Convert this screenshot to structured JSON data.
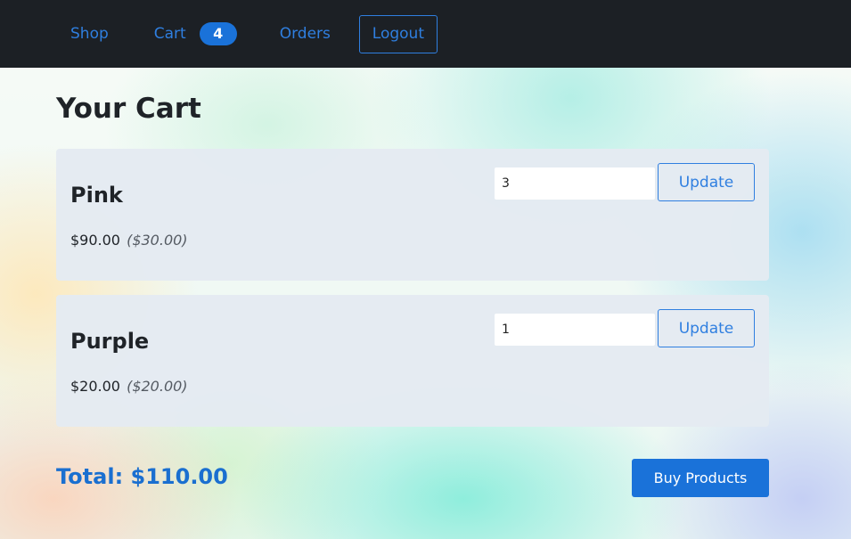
{
  "nav": {
    "shop_label": "Shop",
    "cart_label": "Cart",
    "cart_count": "4",
    "orders_label": "Orders",
    "logout_label": "Logout"
  },
  "page": {
    "title": "Your Cart"
  },
  "cart": {
    "items": [
      {
        "name": "Pink",
        "subtotal": "$90.00",
        "unit_price": "($30.00)",
        "quantity": "3",
        "update_label": "Update"
      },
      {
        "name": "Purple",
        "subtotal": "$20.00",
        "unit_price": "($20.00)",
        "quantity": "1",
        "update_label": "Update"
      }
    ],
    "total": "Total: $110.00",
    "buy_label": "Buy Products"
  },
  "colors": {
    "navbar": "#1c2025",
    "link": "#2f7fe0",
    "primary": "#1a72d9",
    "card": "#e4eaf2"
  }
}
